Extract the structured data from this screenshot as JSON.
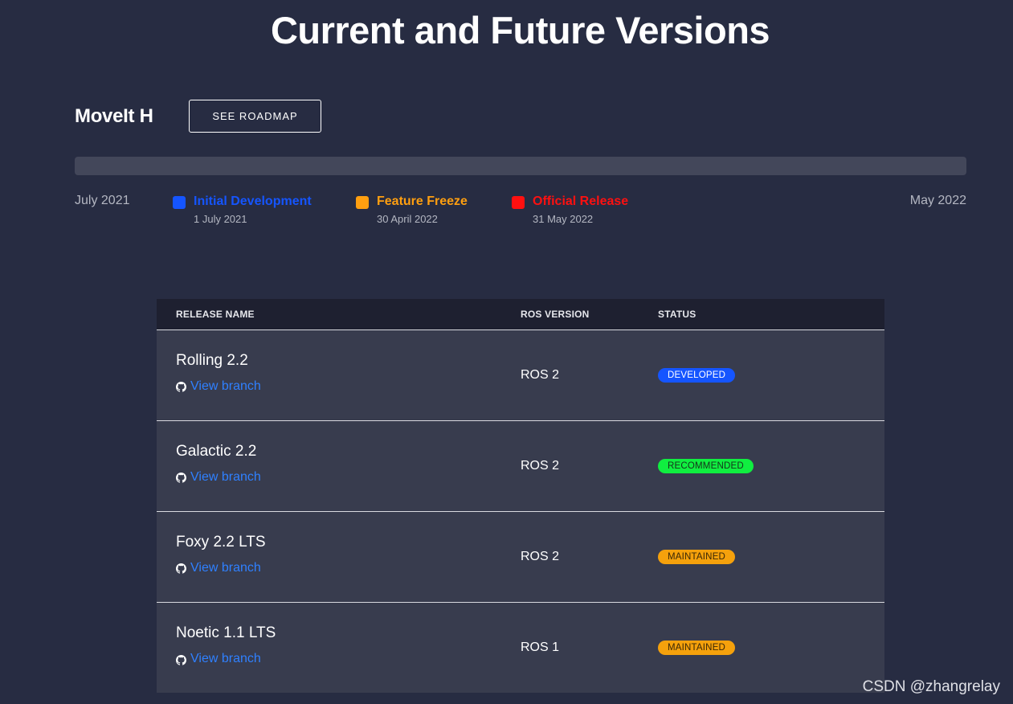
{
  "page": {
    "title": "Current and Future Versions"
  },
  "release": {
    "name": "MoveIt H",
    "roadmap_button": "SEE ROADMAP"
  },
  "timeline": {
    "start_label": "July 2021",
    "end_label": "May 2022",
    "milestones": [
      {
        "title": "Initial Development",
        "date": "1 July 2021",
        "color": "#1555ff"
      },
      {
        "title": "Feature Freeze",
        "date": "30 April 2022",
        "color": "#ff9f10"
      },
      {
        "title": "Official Release",
        "date": "31 May 2022",
        "color": "#ff1010"
      }
    ]
  },
  "table": {
    "headers": {
      "release_name": "RELEASE NAME",
      "ros_version": "ROS VERSION",
      "status": "STATUS"
    },
    "link_label": "View branch",
    "link_icon": "github-icon",
    "rows": [
      {
        "release": "Rolling 2.2",
        "ros": "ROS 2",
        "status": "DEVELOPED",
        "badge_bg": "#1555ff",
        "badge_fg": "#ffffff"
      },
      {
        "release": "Galactic 2.2",
        "ros": "ROS 2",
        "status": "RECOMMENDED",
        "badge_bg": "#10ee40",
        "badge_fg": "#16331c"
      },
      {
        "release": "Foxy 2.2 LTS",
        "ros": "ROS 2",
        "status": "MAINTAINED",
        "badge_bg": "#f5a10c",
        "badge_fg": "#3a2706"
      },
      {
        "release": "Noetic 1.1 LTS",
        "ros": "ROS 1",
        "status": "MAINTAINED",
        "badge_bg": "#f5a10c",
        "badge_fg": "#3a2706"
      }
    ]
  },
  "watermark": "CSDN @zhangrelay"
}
